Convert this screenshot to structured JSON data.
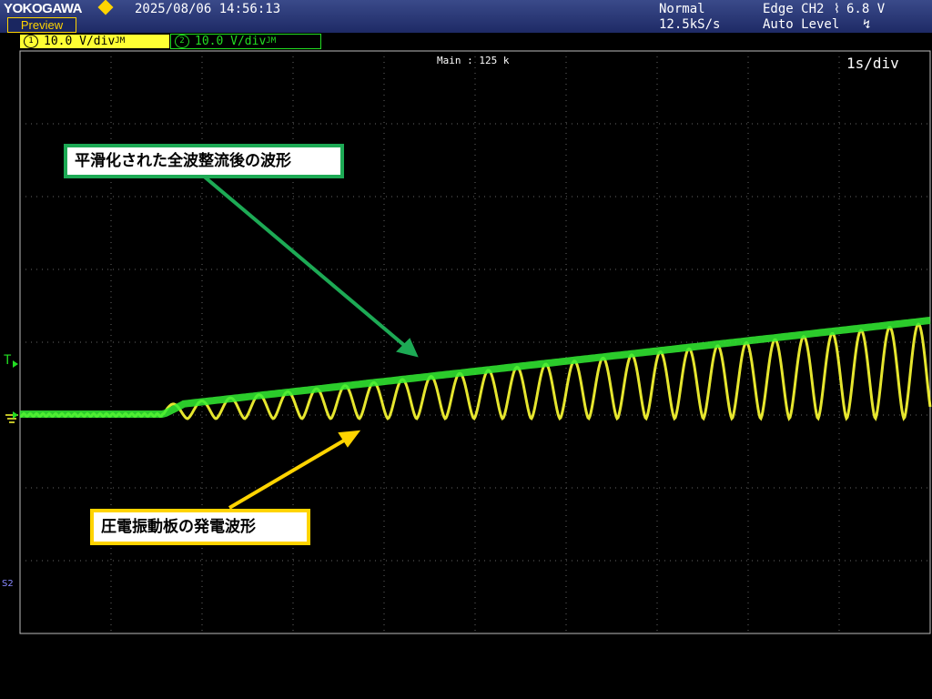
{
  "header": {
    "brand": "YOKOGAWA",
    "datetime": "2025/08/06 14:56:13",
    "mode": "Normal",
    "sample_rate": "12.5kS/s",
    "trigger_source": "Edge CH2",
    "trigger_level": "6.8 V",
    "trigger_mode": "Auto Level",
    "preview_label": "Preview"
  },
  "channels": [
    {
      "num": "1",
      "scale": "10.0 V",
      "unit": "/div",
      "suffix": "JM",
      "color": "#ffff33"
    },
    {
      "num": "2",
      "scale": "10.0 V",
      "unit": "/div",
      "suffix": "JM",
      "color": "#22dd22"
    }
  ],
  "display": {
    "main_label": "Main : 125 k",
    "timebase": "1s/div",
    "trigger_marker": "T",
    "s2_label": "S2"
  },
  "annotations": {
    "green_label": "平滑化された全波整流後の波形",
    "yellow_label": "圧電振動板の発電波形",
    "green_color": "#1daa55",
    "yellow_color": "#ffd400"
  }
}
